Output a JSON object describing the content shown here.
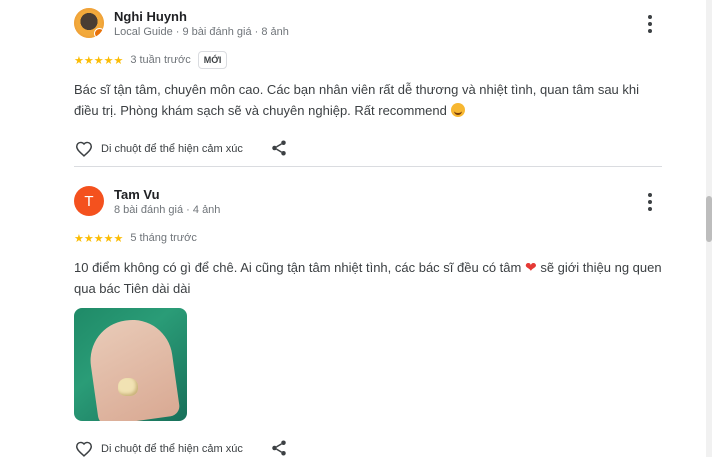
{
  "reviews": [
    {
      "author": "Nghi Huynh",
      "meta": "Local Guide · 9 bài đánh giá · 8 ảnh",
      "stars": "★★★★★",
      "rating": 5,
      "time": "3 tuần trước",
      "badge": "MỚI",
      "text": "Bác sĩ tận tâm, chuyên môn cao. Các bạn nhân viên rất dễ thương và nhiệt tình, quan tâm sau khi điều trị. Phòng khám sạch sẽ và chuyên nghiệp. Rất recommend",
      "react_label": "Di chuột để thể hiện cảm xúc"
    },
    {
      "author": "Tam Vu",
      "avatar_letter": "T",
      "meta": "8 bài đánh giá · 4 ảnh",
      "stars": "★★★★★",
      "rating": 5,
      "time": "5 tháng trước",
      "text_before_emoji": "10 điểm không có gì để chê. Ai cũng tận tâm nhiệt tình, các bác sĩ đều có tâm",
      "text_after_emoji": " sẽ giới thiệu ng quen qua bác Tiên dài dài",
      "react_label": "Di chuột để thể hiện cảm xúc"
    }
  ],
  "icons": {
    "more": "more-vert-icon",
    "heart": "heart-outline-icon",
    "share": "share-icon"
  },
  "colors": {
    "star": "#fbbc04",
    "avatar_letter_bg": "#f4511e",
    "meta_text": "#70757a"
  }
}
